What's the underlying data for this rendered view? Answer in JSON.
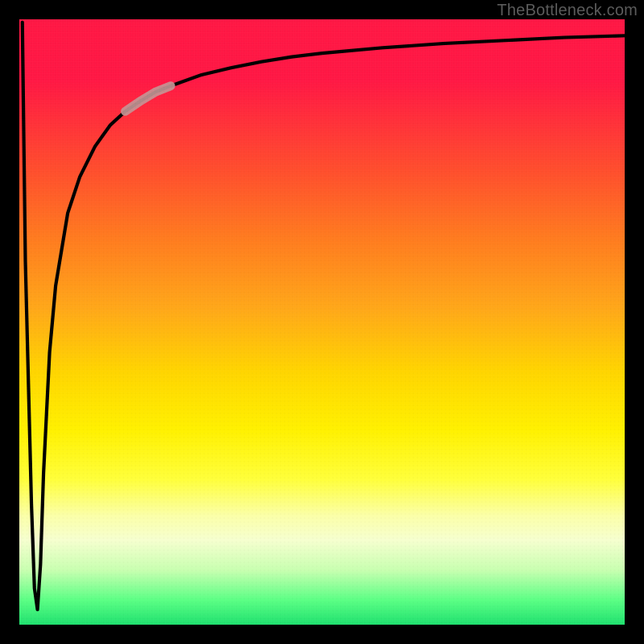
{
  "watermark": "TheBottleneck.com",
  "colors": {
    "background": "#000000",
    "gradient_top": "#ff1744",
    "gradient_bottom": "#1fe06e",
    "curve": "#000000",
    "highlight": "#c49696",
    "watermark_text": "#5b5b5b"
  },
  "chart_data": {
    "type": "line",
    "title": "",
    "xlabel": "",
    "ylabel": "",
    "xlim": [
      0,
      100
    ],
    "ylim": [
      0,
      100
    ],
    "grid": false,
    "series": [
      {
        "name": "curve",
        "x": [
          0.5,
          1.0,
          2.0,
          2.5,
          3.0,
          3.5,
          4.0,
          5.0,
          6.0,
          8.0,
          10.0,
          12.5,
          15.0,
          17.5,
          20.0,
          22.5,
          25.0,
          30.0,
          35.0,
          40.0,
          45.0,
          50.0,
          60.0,
          70.0,
          80.0,
          90.0,
          100.0
        ],
        "y": [
          99.5,
          60.0,
          20.0,
          6.0,
          2.5,
          10.0,
          25.0,
          45.0,
          56.0,
          68.0,
          74.0,
          79.0,
          82.5,
          84.8,
          86.5,
          88.0,
          89.0,
          90.8,
          92.0,
          93.0,
          93.8,
          94.4,
          95.3,
          96.0,
          96.5,
          97.0,
          97.3
        ]
      }
    ],
    "highlight_segment": {
      "series": "curve",
      "x_start": 17.5,
      "x_end": 25.0
    }
  }
}
